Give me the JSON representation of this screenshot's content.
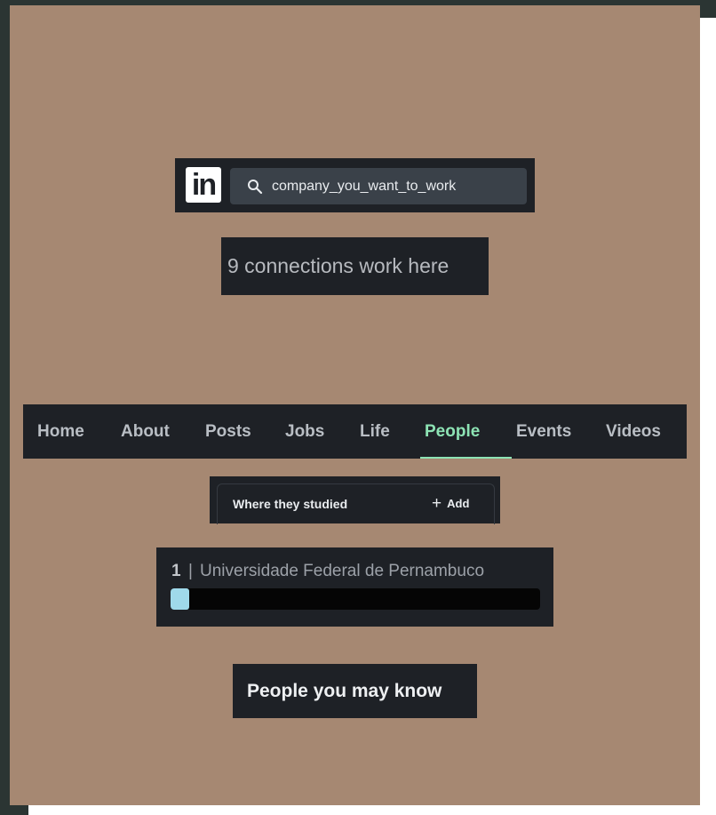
{
  "topbar": {
    "logo_text": "in",
    "search": {
      "value": "company_you_want_to_work",
      "icon": "search-icon"
    }
  },
  "company": {
    "connections_text": "9 connections work here"
  },
  "nav": {
    "tabs": [
      {
        "label": "Home"
      },
      {
        "label": "About"
      },
      {
        "label": "Posts"
      },
      {
        "label": "Jobs"
      },
      {
        "label": "Life"
      },
      {
        "label": "People",
        "active": true
      },
      {
        "label": "Events"
      },
      {
        "label": "Videos"
      }
    ],
    "active_color": "#8de3b4"
  },
  "studied": {
    "label": "Where they studied",
    "add_label": "Add",
    "add_icon": "plus-icon"
  },
  "schools": [
    {
      "count": "1",
      "separator": "|",
      "name": "Universidade Federal de Pernambuco",
      "fill_fraction": 0.05,
      "bar_color": "#9fd9ea"
    }
  ],
  "people": {
    "heading": "People you may know"
  },
  "colors": {
    "card_background": "#a68872",
    "panel_background": "#1e2126",
    "search_background": "#3a4149",
    "frame_background": "#2b3533"
  }
}
